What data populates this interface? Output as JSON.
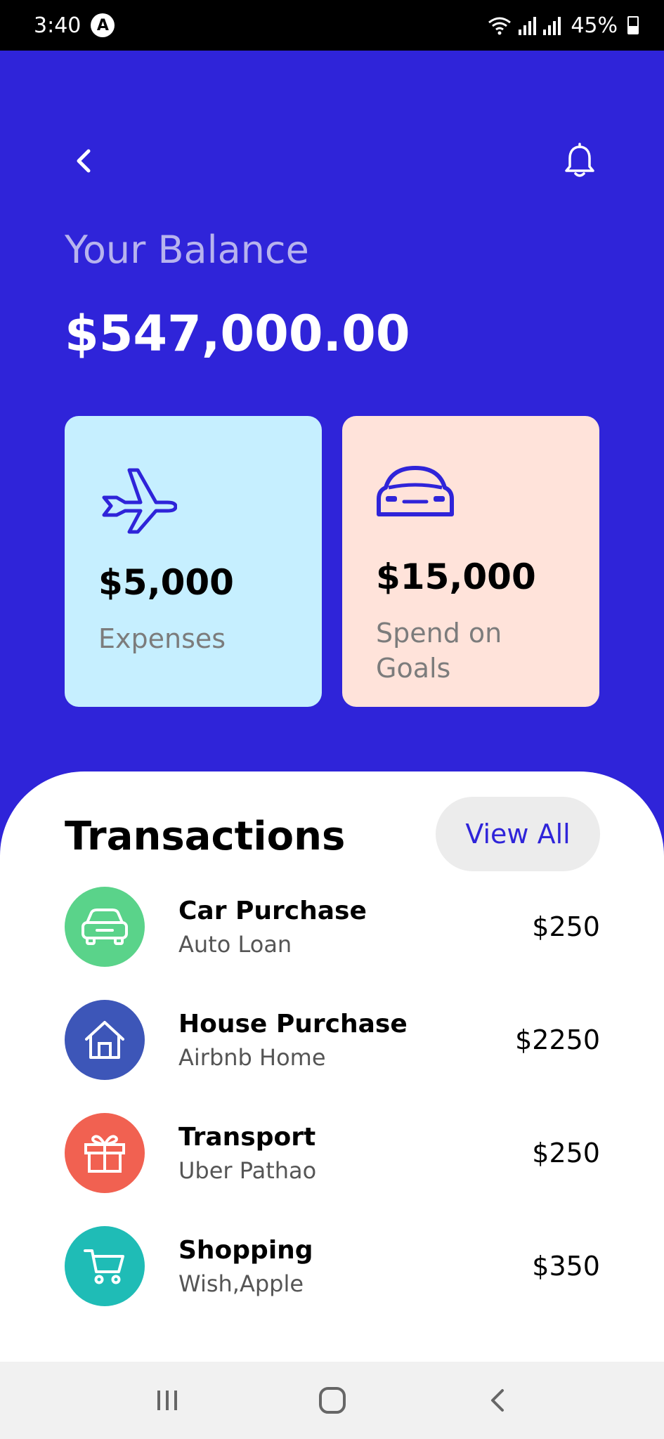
{
  "status_bar": {
    "time": "3:40",
    "badge": "A",
    "battery": "45%"
  },
  "header": {
    "back_icon": "chevron-left-icon",
    "notification_icon": "bell-icon"
  },
  "balance": {
    "label": "Your Balance",
    "amount": "$547,000.00"
  },
  "cards": [
    {
      "icon": "airplane-icon",
      "amount": "$5,000",
      "label": "Expenses",
      "color": "#c6efff"
    },
    {
      "icon": "car-icon",
      "amount": "$15,000",
      "label": "Spend on Goals",
      "color": "#ffe3da"
    }
  ],
  "transactions": {
    "title": "Transactions",
    "view_all_label": "View All",
    "items": [
      {
        "icon": "car-icon",
        "color": "#5ad38a",
        "name": "Car Purchase",
        "sub": "Auto Loan",
        "amount": "$250"
      },
      {
        "icon": "house-icon",
        "color": "#3d56b8",
        "name": "House Purchase",
        "sub": "Airbnb Home",
        "amount": "$2250"
      },
      {
        "icon": "gift-icon",
        "color": "#f16151",
        "name": "Transport",
        "sub": "Uber Pathao",
        "amount": "$250"
      },
      {
        "icon": "cart-icon",
        "color": "#1fbcb6",
        "name": "Shopping",
        "sub": "Wish,Apple",
        "amount": "$350"
      }
    ]
  },
  "theme": {
    "primary": "#2f24d9",
    "sheet": "#ffffff"
  },
  "nav": {
    "recents_icon": "recent-apps-icon",
    "home_icon": "home-button-icon",
    "back_icon": "system-back-icon"
  }
}
